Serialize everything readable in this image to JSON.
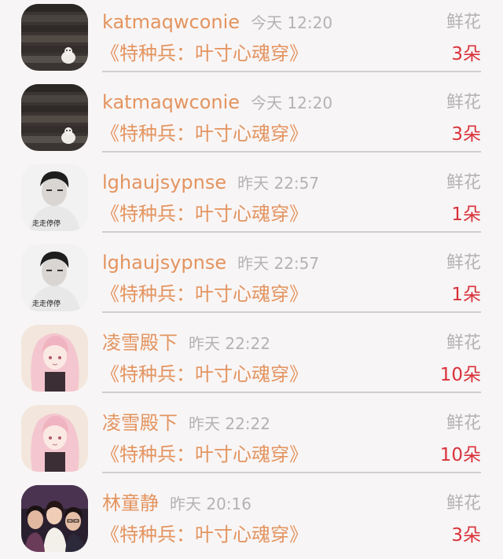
{
  "items": [
    {
      "name": "katmaqwconie",
      "time": "今天 12:20",
      "gift": "鲜花",
      "book": "《特种兵：叶寸心魂穿》",
      "count": "3朵",
      "avatar": "staircase-cat"
    },
    {
      "name": "katmaqwconie",
      "time": "今天 12:20",
      "gift": "鲜花",
      "book": "《特种兵：叶寸心魂穿》",
      "count": "3朵",
      "avatar": "staircase-cat"
    },
    {
      "name": "lghaujsypnse",
      "time": "昨天 22:57",
      "gift": "鲜花",
      "book": "《特种兵：叶寸心魂穿》",
      "count": "1朵",
      "avatar": "portrait-boy",
      "avatar_caption": "走走停停"
    },
    {
      "name": "lghaujsypnse",
      "time": "昨天 22:57",
      "gift": "鲜花",
      "book": "《特种兵：叶寸心魂穿》",
      "count": "1朵",
      "avatar": "portrait-boy",
      "avatar_caption": "走走停停"
    },
    {
      "name": "凌雪殿下",
      "time": "昨天 22:22",
      "gift": "鲜花",
      "book": "《特种兵：叶寸心魂穿》",
      "count": "10朵",
      "avatar": "anime-girl"
    },
    {
      "name": "凌雪殿下",
      "time": "昨天 22:22",
      "gift": "鲜花",
      "book": "《特种兵：叶寸心魂穿》",
      "count": "10朵",
      "avatar": "anime-girl"
    },
    {
      "name": "林童静",
      "time": "昨天 20:16",
      "gift": "鲜花",
      "book": "《特种兵：叶寸心魂穿》",
      "count": "3朵",
      "avatar": "group-photo"
    }
  ],
  "colors": {
    "name": "#e3945f",
    "time": "#b3b3b3",
    "count": "#d9323a",
    "background": "#f8f5f6"
  }
}
